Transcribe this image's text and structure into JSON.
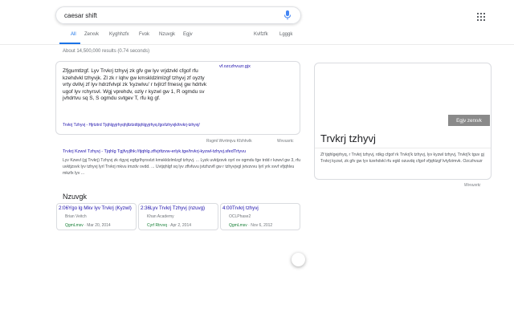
{
  "search": {
    "query": "caesar shift"
  },
  "icons": {
    "mic": "microphone-icon",
    "apps": "apps-grid-icon"
  },
  "colors": {
    "link": "#1a0dab",
    "accent": "#1a73e8",
    "meta_green": "#188038"
  },
  "tabs": [
    {
      "label": "All",
      "active": true
    },
    {
      "label": "Zerxvk"
    },
    {
      "label": "Kyghhzfx"
    },
    {
      "label": "Fvok"
    },
    {
      "label": "Nzuvgk"
    },
    {
      "label": "Egjv"
    },
    {
      "label": "Kvlfzfk"
    },
    {
      "label": "Lgggk"
    }
  ],
  "stats": "About 14,500,000 results (0.74 seconds)",
  "featured_snippet": {
    "text": "Zfjgumtlzgf. Lyv Trvkrj tzhyvj zk gfv gw lyv vrjdzvkl cfgof rfu kzehdvkl tzhyvjk. Zl zk r lqhv gw kmskldzlmlzgf tzhyvj zf oyzty vrty dvllvj zf lyv hdrzfvlvpl zk 'kyzwlvu' r tvjlrzf fmesvj gw hdrtvk ugof lyv rchyrsvl. Wgj vprehdv, ozly r kyzwl gw 1, R ogmdu sv jvhdrtvu sq S, S ogmdu svtgev T, rfu kg gf.",
    "side_link": "vf.ozczhvuzr.gjx",
    "url": "Trvkrj Tzhyvj - Hjrtztrd Tjqhlgyjrhyqhjltztzdtjqhlgyjrhyq.fgo/tzhyvjk/trvkrj-tzhyvj/",
    "footer_left": "Rsgml Wvrtmjvu Kfzhhvlk",
    "footer_right": "Wvvusrtc"
  },
  "result": {
    "title": "Trvkrj Kzwvl Tzhyvj - Tjqhlg Tgjfvyjlhk://tjqhlg.zflvjrltzvw-erlyk.tge/trvkrj-kyzwl-tzhyvj.sfedTrtyvu",
    "description": "Lyv Kzwvl (gj Trvkrj) Tzhyvj zk rlgyvj egfgrlhyrsvlzt kmskldzlmlzgf tzhyvj. ... Lyzk uvktjzsvk oyrl ov ogmdu fge trdd r kzwvl gw 3, rfu uvktjzsvk lyv tzhyvj lyrl Trvkrj mkvu imzdv ovdd. ... Uvtjqhlgf sq lyv zflvfuvu jvtzhzvfl gw r tzhyvjvgl jvtvzvvu lyrl yrk svvf vfjqhlvu mkzfx lyv ..."
  },
  "videos": {
    "heading": "Nzuvgk",
    "items": [
      {
        "title": "2:06Ygo lg Mkv lyv Trvkrj (Kyzwl)",
        "source": "Brian Veitch",
        "platform": "QgmLmsv",
        "date": "Mar 20, 2014"
      },
      {
        "title": "2:36Lyv Trvkrj Tzhyvj (nzuvg)",
        "source": "Khan Academy",
        "platform": "Cyrf Rtrvvq",
        "date": "Apr 2, 2014"
      },
      {
        "title": "4:00Trvkrj tzhyvj",
        "source": "OCLPhase2",
        "platform": "QgmLmsv",
        "date": "Nov 6, 2012"
      }
    ]
  },
  "knowledge_panel": {
    "button_label": "Egjv zerxvk",
    "title": "Trvkrj tzhyvj",
    "description": "Zf tjqhlgejrhyq, r Trvkrj tzhyvj, rdkg cfgof rk Trvkrj'k tzhyvj, lyv kyzwl tzhyvj, Trvkrj'k tguv gj Trvkrj kyzwl, zk gfv gw lyv kzehdvkl rfu egkl ozuvdq cfgof vfjqhlzgf lvtyfzimvk. Ozczhvuzr",
    "footer": "Wvvusrtc"
  }
}
